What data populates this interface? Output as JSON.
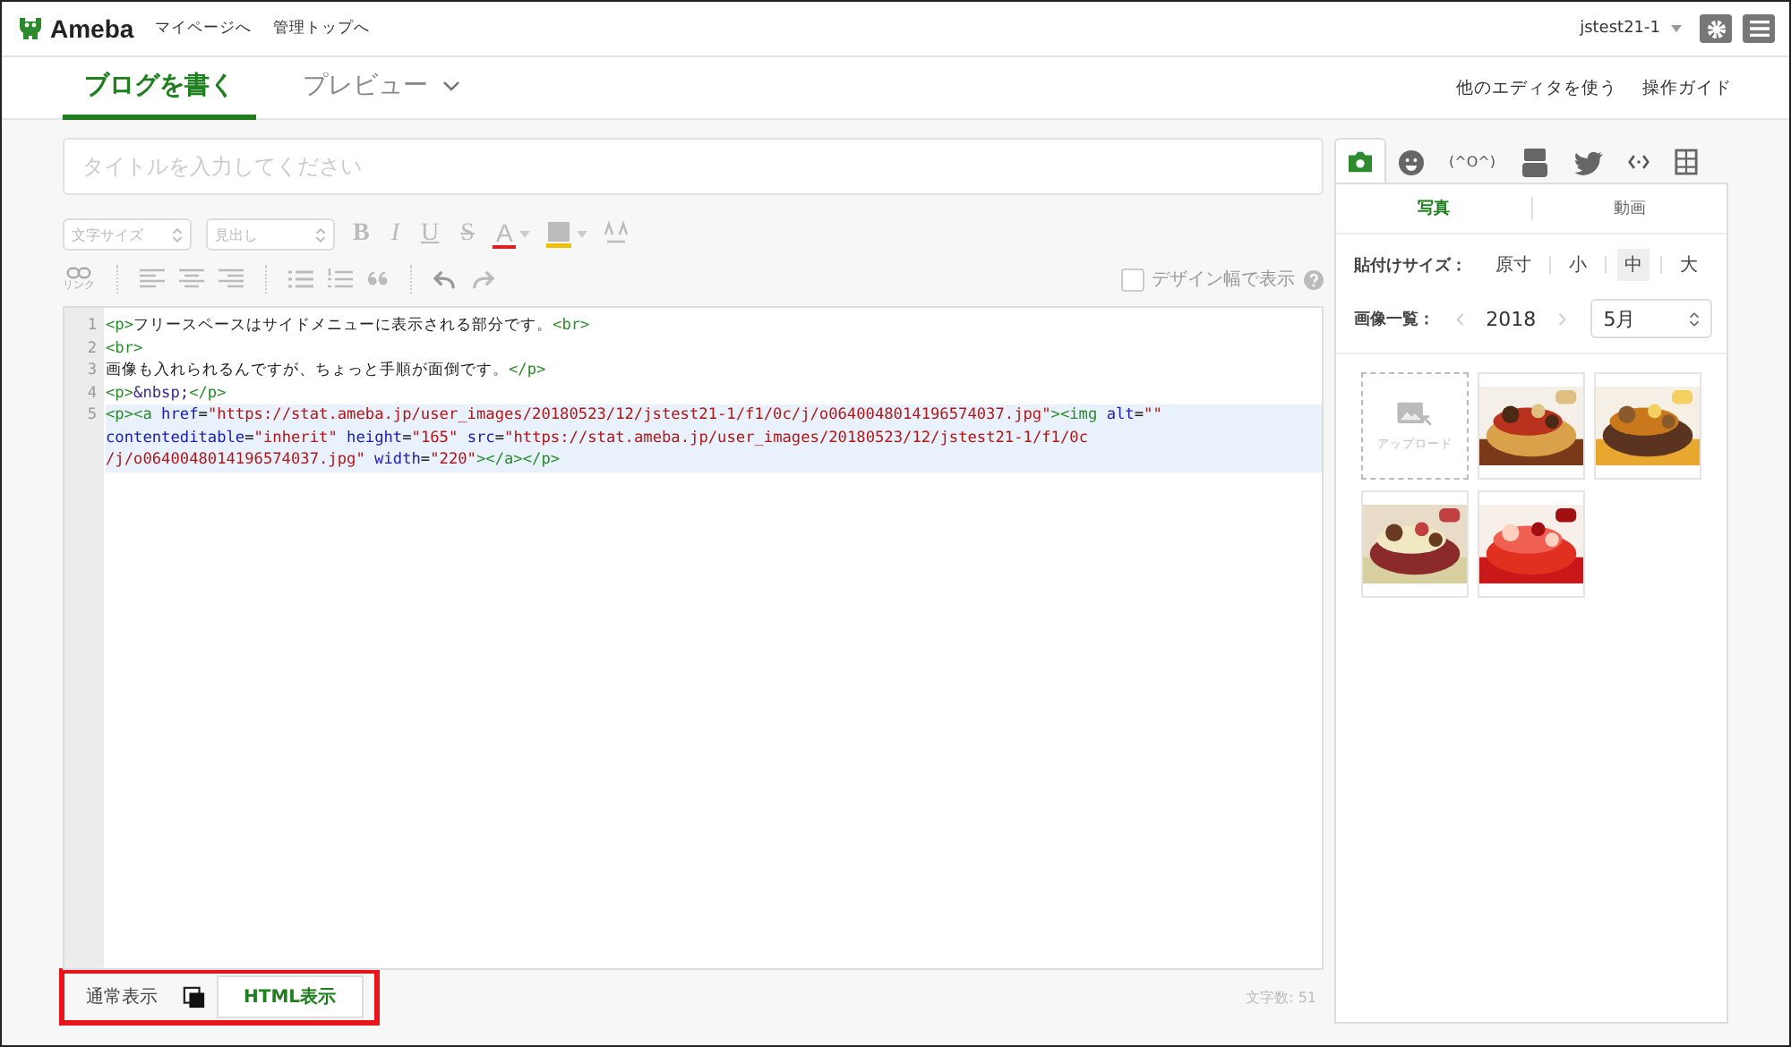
{
  "header": {
    "logo": "Ameba",
    "links": [
      "マイページへ",
      "管理トップへ"
    ],
    "user": "jstest21-1"
  },
  "tabs": [
    {
      "label": "ブログを書く",
      "selected": true
    },
    {
      "label": "プレビュー",
      "selected": false
    }
  ],
  "header_links": [
    "他のエディタを使う",
    "操作ガイド"
  ],
  "title_field": {
    "placeholder": "タイトルを入力してください"
  },
  "toolbar": {
    "font_size": "文字サイズ",
    "heading": "見出し",
    "bold": "B",
    "italic": "I",
    "underline": "U",
    "strike": "S",
    "font_color": "A",
    "link_label": "リンク",
    "design_width": {
      "label": "デザイン幅で表示",
      "checked": false
    }
  },
  "code_lines": [
    {
      "number": "1",
      "selected": false,
      "rows": [
        {
          "tokens": [
            {
              "kind": "tag",
              "text": "<p>"
            },
            {
              "kind": "text",
              "text": "フリースペースはサイドメニューに表示される部分です。"
            },
            {
              "kind": "tag",
              "text": "<br>"
            }
          ]
        }
      ]
    },
    {
      "number": "2",
      "selected": false,
      "rows": [
        {
          "tokens": [
            {
              "kind": "tag",
              "text": "<br>"
            }
          ]
        }
      ]
    },
    {
      "number": "3",
      "selected": false,
      "rows": [
        {
          "tokens": [
            {
              "kind": "text",
              "text": "画像も入れられるんですが、ちょっと手順が面倒です。"
            },
            {
              "kind": "tag",
              "text": "</p>"
            }
          ]
        }
      ]
    },
    {
      "number": "4",
      "selected": false,
      "rows": [
        {
          "tokens": [
            {
              "kind": "tag",
              "text": "<p>"
            },
            {
              "kind": "entity",
              "text": "&nbsp;"
            },
            {
              "kind": "tag",
              "text": "</p>"
            }
          ]
        }
      ]
    },
    {
      "number": "5",
      "selected": true,
      "rows": [
        {
          "tokens": [
            {
              "kind": "tag",
              "text": "<p><a"
            },
            {
              "kind": "attr",
              "text": " href"
            },
            {
              "kind": "text",
              "text": "="
            },
            {
              "kind": "string",
              "text": "\"https://stat.ameba.jp/user_images/20180523/12/jstest21-1/f1/0c/j/o0640048014196574037.jpg\""
            },
            {
              "kind": "tag",
              "text": "><img"
            },
            {
              "kind": "attr",
              "text": " alt"
            },
            {
              "kind": "text",
              "text": "="
            },
            {
              "kind": "string",
              "text": "\"\""
            }
          ]
        },
        {
          "tokens": [
            {
              "kind": "attr",
              "text": "contenteditable"
            },
            {
              "kind": "text",
              "text": "="
            },
            {
              "kind": "string",
              "text": "\"inherit\""
            },
            {
              "kind": "attr",
              "text": " height"
            },
            {
              "kind": "text",
              "text": "="
            },
            {
              "kind": "string",
              "text": "\"165\""
            },
            {
              "kind": "attr",
              "text": " src"
            },
            {
              "kind": "text",
              "text": "="
            },
            {
              "kind": "string",
              "text": "\"https://stat.ameba.jp/user_images/20180523/12/jstest21-1/f1/0c"
            }
          ]
        },
        {
          "tokens": [
            {
              "kind": "string",
              "text": "/j/o0640048014196574037.jpg\""
            },
            {
              "kind": "attr",
              "text": " width"
            },
            {
              "kind": "text",
              "text": "="
            },
            {
              "kind": "string",
              "text": "\"220\""
            },
            {
              "kind": "tag",
              "text": "></a></p>"
            }
          ]
        }
      ]
    }
  ],
  "side_tabs": [
    {
      "kind": "camera",
      "selected": true
    },
    {
      "kind": "face",
      "selected": false
    },
    {
      "kind": "emoticon",
      "label": "(^O^)",
      "selected": false
    },
    {
      "kind": "video",
      "selected": false
    },
    {
      "kind": "bird",
      "selected": false
    },
    {
      "kind": "code",
      "selected": false
    },
    {
      "kind": "grid",
      "selected": false
    }
  ],
  "media_tabs": [
    {
      "label": "写真",
      "selected": true
    },
    {
      "label": "動画",
      "selected": false
    }
  ],
  "paste_size": {
    "label": "貼付けサイズ：",
    "options": [
      {
        "label": "原寸",
        "selected": false
      },
      {
        "label": "小",
        "selected": false
      },
      {
        "label": "中",
        "selected": true
      },
      {
        "label": "大",
        "selected": false
      }
    ]
  },
  "image_list": {
    "label": "画像一覧：",
    "year": "2018",
    "month": "5月"
  },
  "upload": "アップロード",
  "photos": [
    {
      "kind": "picture"
    },
    {
      "kind": "picture"
    },
    {
      "kind": "picture"
    },
    {
      "kind": "picture"
    }
  ],
  "view_modes": [
    {
      "label": "通常表示",
      "selected": false
    },
    {
      "label": "HTML表示",
      "selected": true
    }
  ],
  "char_count": "文字数: 51"
}
